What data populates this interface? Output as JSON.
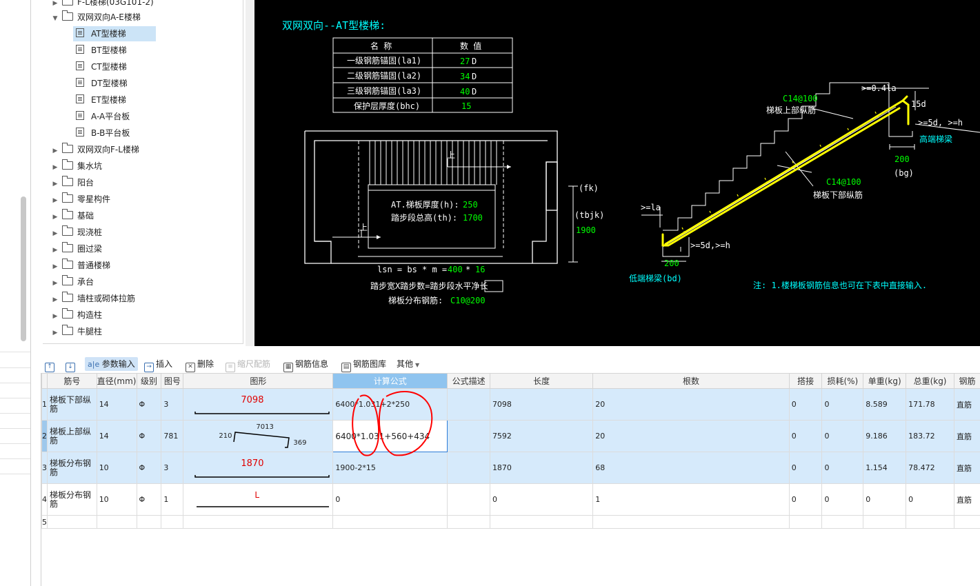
{
  "tree": {
    "items": [
      {
        "label": "F-L楼梯(03G101-2)",
        "type": "folder",
        "indent": 1,
        "expanded": false
      },
      {
        "label": "双网双向A-E楼梯",
        "type": "folder",
        "indent": 1,
        "expanded": true
      },
      {
        "label": "AT型楼梯",
        "type": "doc",
        "indent": 2,
        "selected": true
      },
      {
        "label": "BT型楼梯",
        "type": "doc",
        "indent": 2
      },
      {
        "label": "CT型楼梯",
        "type": "doc",
        "indent": 2
      },
      {
        "label": "DT型楼梯",
        "type": "doc",
        "indent": 2
      },
      {
        "label": "ET型楼梯",
        "type": "doc",
        "indent": 2
      },
      {
        "label": "A-A平台板",
        "type": "doc",
        "indent": 2
      },
      {
        "label": "B-B平台板",
        "type": "doc",
        "indent": 2
      },
      {
        "label": "双网双向F-L楼梯",
        "type": "folder",
        "indent": 1
      },
      {
        "label": "集水坑",
        "type": "folder",
        "indent": 1
      },
      {
        "label": "阳台",
        "type": "folder",
        "indent": 1
      },
      {
        "label": "零星构件",
        "type": "folder",
        "indent": 1
      },
      {
        "label": "基础",
        "type": "folder",
        "indent": 1
      },
      {
        "label": "现浇桩",
        "type": "folder",
        "indent": 1
      },
      {
        "label": "圈过梁",
        "type": "folder",
        "indent": 1
      },
      {
        "label": "普通楼梯",
        "type": "folder",
        "indent": 1
      },
      {
        "label": "承台",
        "type": "folder",
        "indent": 1
      },
      {
        "label": "墙柱或砌体拉筋",
        "type": "folder",
        "indent": 1
      },
      {
        "label": "构造柱",
        "type": "folder",
        "indent": 1
      },
      {
        "label": "牛腿柱",
        "type": "folder",
        "indent": 1
      }
    ]
  },
  "cad": {
    "title": "双网双向--AT型楼梯:",
    "table_header": [
      "名 称",
      "数 值"
    ],
    "table_rows": [
      {
        "name": "一级钢筋锚固(la1)",
        "value": "27",
        "unit": "D"
      },
      {
        "name": "二级钢筋锚固(la2)",
        "value": "34",
        "unit": "D"
      },
      {
        "name": "三级钢筋锚固(la3)",
        "value": "40",
        "unit": "D"
      },
      {
        "name": "保护层厚度(bhc)",
        "value": "15",
        "unit": ""
      }
    ],
    "plan_up1": "上",
    "plan_up2": "上",
    "thick_label": "AT.梯板厚度(h):",
    "thick_value": "250",
    "height_label": "踏步段总高(th):",
    "height_value": "1700",
    "fk": "(fk)",
    "tbjk": "(tbjk)",
    "dim_1900": "1900",
    "lsn_formula": "lsn = bs * m =",
    "bs_value": "400",
    "star": "*",
    "m_value": "16",
    "step_note": "踏步宽X踏步数=踏步段水平净长",
    "dist_label": "梯板分布钢筋:",
    "dist_value": "C10@200",
    "top_bar_spec": "C14@100",
    "top_bar_label": "梯板上部纵筋",
    "bot_bar_spec": "C14@100",
    "bot_bar_label": "梯板下部纵筋",
    "len_04la": ">=0.4la",
    "len_15d": "15d",
    "len_5d_h_top": ">=5d, >=h",
    "high_beam": "高端梯梁",
    "dim_200_top": "200",
    "bg": "(bg)",
    "len_la": ">=la",
    "len_5d_h_bot": ">=5d,>=h",
    "dim_200_bot": "200",
    "low_beam": "低端梯梁(bd)",
    "note": "注: 1.楼梯板钢筋信息也可在下表中直接输入."
  },
  "toolbar": {
    "up": "↑",
    "down": "↓",
    "param_input": "参数输入",
    "insert": "插入",
    "delete": "删除",
    "scale_rebar": "缩尺配筋",
    "rebar_info": "钢筋信息",
    "rebar_lib": "钢筋图库",
    "other": "其他"
  },
  "grid": {
    "headers": [
      "筋号",
      "直径(mm)",
      "级别",
      "图号",
      "图形",
      "计算公式",
      "公式描述",
      "长度",
      "根数",
      "搭接",
      "损耗(%)",
      "单重(kg)",
      "总重(kg)",
      "钢筋"
    ],
    "rows": [
      {
        "num": "1",
        "name": "梯板下部纵筋",
        "dia": "14",
        "grade": "Φ",
        "fig": "3",
        "shape_val": "7098",
        "formula": "6400*1.031+2*250",
        "desc": "",
        "length": "7098",
        "count": "20",
        "lap": "0",
        "loss": "0",
        "unit_wt": "8.589",
        "total_wt": "171.78",
        "kind": "直筋"
      },
      {
        "num": "2",
        "name": "梯板上部纵筋",
        "dia": "14",
        "grade": "Φ",
        "fig": "781",
        "shape_a": "210",
        "shape_b": "7013",
        "shape_c": "369",
        "formula": "6400*1.031+560+434",
        "desc": "",
        "length": "7592",
        "count": "20",
        "lap": "0",
        "loss": "0",
        "unit_wt": "9.186",
        "total_wt": "183.72",
        "kind": "直筋"
      },
      {
        "num": "3",
        "name": "梯板分布钢筋",
        "dia": "10",
        "grade": "Φ",
        "fig": "3",
        "shape_val": "1870",
        "formula": "1900-2*15",
        "desc": "",
        "length": "1870",
        "count": "68",
        "lap": "0",
        "loss": "0",
        "unit_wt": "1.154",
        "total_wt": "78.472",
        "kind": "直筋"
      },
      {
        "num": "4",
        "name": "梯板分布钢筋",
        "dia": "10",
        "grade": "Φ",
        "fig": "1",
        "shape_val": "L",
        "formula": "0",
        "desc": "",
        "length": "0",
        "count": "1",
        "lap": "0",
        "loss": "0",
        "unit_wt": "0",
        "total_wt": "0",
        "kind": "直筋"
      },
      {
        "num": "5"
      }
    ]
  },
  "colors": {
    "cad_bg": "#000000",
    "cad_white": "#ffffff",
    "cad_green": "#00ff00",
    "cad_cyan": "#00ffff",
    "rebar_yellow": "#ffff00",
    "annotation_red": "#ff0000",
    "selection_blue": "#cce4f7"
  }
}
